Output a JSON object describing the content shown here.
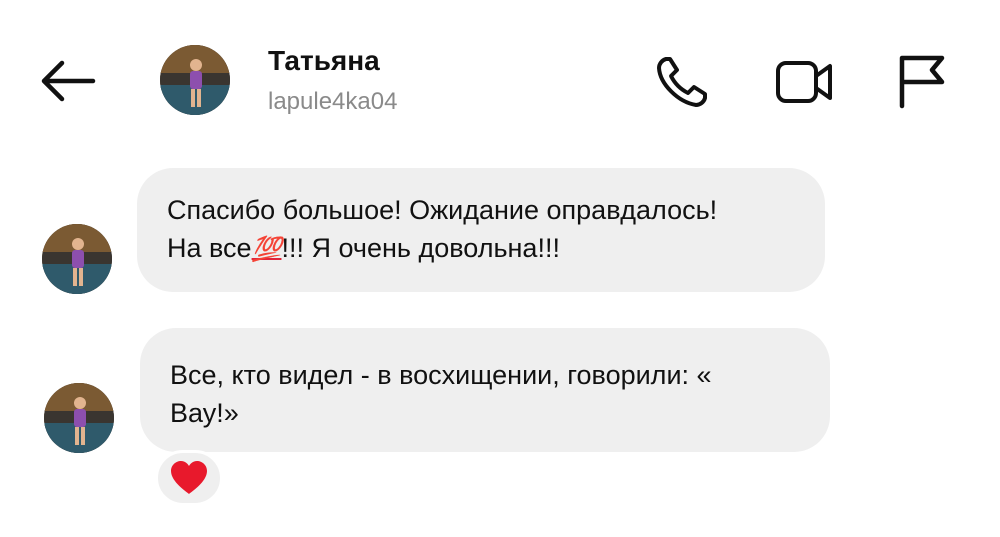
{
  "header": {
    "contact_name": "Татьяна",
    "contact_username": "lapule4ka04",
    "icons": {
      "back": "arrow-left-icon",
      "call": "phone-icon",
      "video": "video-camera-icon",
      "report": "flag-icon"
    }
  },
  "messages": [
    {
      "sender": "Татьяна",
      "line1": "Спасибо большое! Ожидание оправдалось!",
      "line2_before": "На все",
      "emoji": "💯",
      "line2_after": "!!! Я очень довольна!!!"
    },
    {
      "sender": "Татьяна",
      "line1": "Все, кто видел - в восхищении, говорили: «",
      "line2": "Вау!»",
      "reaction": "❤️"
    }
  ],
  "colors": {
    "bubble_background": "#efefef",
    "username_gray": "#8a8a8a",
    "heart_red": "#e8192c"
  }
}
